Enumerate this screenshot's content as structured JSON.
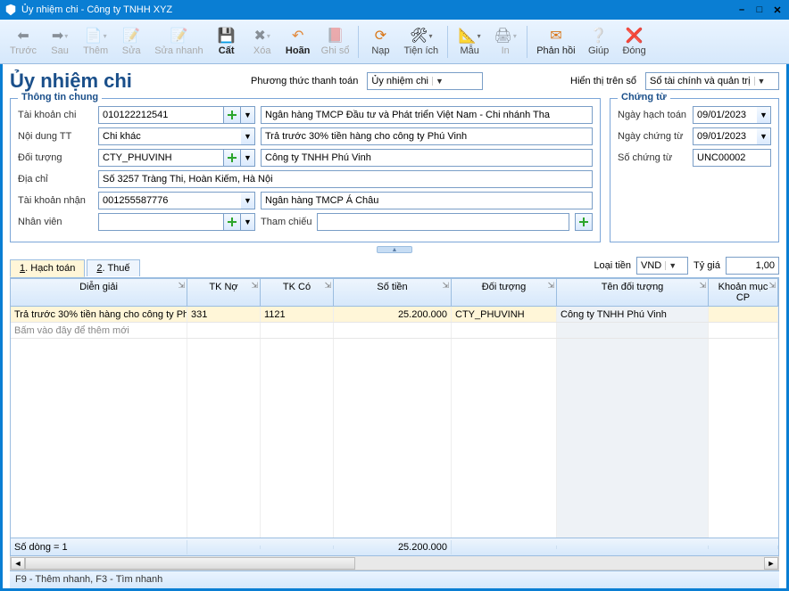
{
  "window": {
    "title": "Ủy nhiệm chi - Công ty TNHH XYZ"
  },
  "toolbar": {
    "prev": "Trước",
    "next": "Sau",
    "add": "Thêm",
    "edit": "Sửa",
    "quickedit": "Sửa nhanh",
    "cut": "Cất",
    "delete": "Xóa",
    "undo": "Hoãn",
    "post": "Ghi sổ",
    "load": "Nạp",
    "utility": "Tiện ích",
    "template": "Mẫu",
    "print": "In",
    "feedback": "Phản hồi",
    "help": "Giúp",
    "close": "Đóng"
  },
  "header": {
    "title": "Ủy nhiệm chi",
    "payment_method_label": "Phương thức thanh toán",
    "payment_method_value": "Ủy nhiệm chi",
    "display_book_label": "Hiển thị trên sổ",
    "display_book_value": "Sổ tài chính và quản trị"
  },
  "general": {
    "legend": "Thông tin chung",
    "account_label": "Tài khoản chi",
    "account_value": "010122212541",
    "bank_value": "Ngân hàng TMCP Đầu tư và Phát triển Việt Nam - Chi nhánh Tha",
    "content_label": "Nội dung TT",
    "content_value": "Chi khác",
    "content_desc": "Trả trước 30% tiền hàng cho công ty Phú Vinh",
    "object_label": "Đối tượng",
    "object_code": "CTY_PHUVINH",
    "object_name": "Công ty TNHH Phú Vinh",
    "address_label": "Địa chỉ",
    "address_value": "Số 3257 Tràng Thi, Hoàn Kiếm, Hà Nội",
    "recv_account_label": "Tài khoản nhận",
    "recv_account_value": "001255587776",
    "recv_bank_value": "Ngân hàng TMCP Á Châu",
    "employee_label": "Nhân viên",
    "employee_value": "",
    "ref_label": "Tham chiếu"
  },
  "voucher": {
    "legend": "Chứng từ",
    "post_date_label": "Ngày hạch toán",
    "post_date_value": "09/01/2023",
    "voucher_date_label": "Ngày chứng từ",
    "voucher_date_value": "09/01/2023",
    "voucher_no_label": "Số chứng từ",
    "voucher_no_value": "UNC00002"
  },
  "tabs": {
    "t1_num": "1",
    "t1": "Hạch toán",
    "t2_num": "2",
    "t2": "Thuế"
  },
  "currency": {
    "label": "Loại tiền",
    "value": "VND",
    "rate_label": "Tỷ giá",
    "rate_value": "1,00"
  },
  "grid": {
    "cols": {
      "desc": "Diễn giải",
      "tkno": "TK Nợ",
      "tkco": "TK Có",
      "sotien": "Số tiền",
      "doituong": "Đối tượng",
      "tendt": "Tên đối tượng",
      "kmcp": "Khoản mục CP"
    },
    "row": {
      "desc": "Trả trước 30% tiền hàng cho công ty Ph",
      "tkno": "331",
      "tkco": "1121",
      "sotien": "25.200.000",
      "doituong": "CTY_PHUVINH",
      "tendt": "Công ty TNHH Phú Vinh",
      "kmcp": ""
    },
    "newrow_hint": "Bấm vào đây để thêm mới",
    "footer_count": "Số dòng = 1",
    "footer_sum": "25.200.000"
  },
  "statusbar": "F9 - Thêm nhanh, F3 - Tìm nhanh"
}
